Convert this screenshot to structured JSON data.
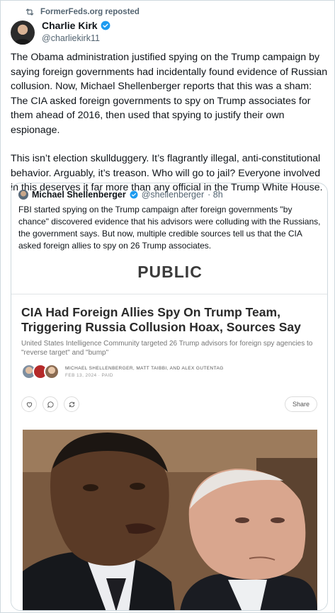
{
  "repost": {
    "text": "FormerFeds.org reposted"
  },
  "author": {
    "name": "Charlie Kirk",
    "handle": "@charliekirk11"
  },
  "post": {
    "paragraph1": "The Obama administration justified spying on the Trump campaign by saying foreign governments had incidentally found evidence of Russian collusion. Now, Michael Shellenberger reports that this was a sham: The CIA asked foreign governments to spy on Trump associates for them ahead of 2016, then used that spying to justify their own espionage.",
    "paragraph2": "This isn’t election skullduggery. It’s flagrantly illegal, anti-constitutional behavior. Arguably, it’s treason. Who will go to jail? Everyone involved in this deserves it far more than any official in the Trump White House."
  },
  "quote": {
    "name": "Michael Shellenberger",
    "handle": "@shellenberger",
    "time": "· 8h",
    "text": "FBI started spying on the Trump campaign after foreign governments \"by chance\" discovered evidence that his advisors were colluding with the Russians, the government says. But now, multiple credible sources tell us that the CIA asked foreign allies to spy on 26 Trump associates."
  },
  "card": {
    "logo": "PUBLIC",
    "headline": "CIA Had Foreign Allies Spy On Trump Team, Triggering Russia Collusion Hoax, Sources Say",
    "subhead": "United States Intelligence Community targeted 26 Trump advisors for foreign spy agencies to \"reverse target\" and \"bump\"",
    "authors": "MICHAEL SHELLENBERGER, MATT TAIBBI, AND ALEX GUTENTAG",
    "date": "FEB 13, 2024 · PAID",
    "share_label": "Share"
  },
  "colors": {
    "verified": "#1d9bf0",
    "muted": "#536471",
    "border": "#cfd9de"
  }
}
